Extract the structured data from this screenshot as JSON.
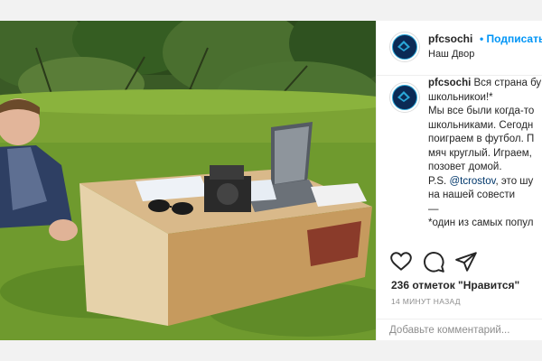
{
  "post": {
    "username": "pfcsochi",
    "follow_label": "• Подписаться",
    "location": "Наш Двор",
    "caption_lines": [
      "Вся страна бу",
      "школьникои!*",
      "Мы все были когда-то",
      "школьниками. Сегодн",
      "поиграем в футбол. П",
      "мяч круглый. Играем,",
      "позовет домой.",
      "P.S. ",
      "на нашей совести",
      "—",
      "*один из самых попул"
    ],
    "caption_mention": "@tcrostov",
    "caption_mention_after": ", это шу",
    "likes_text": "236 отметок \"Нравится\"",
    "time_text": "14 МИНУТ НАЗАД",
    "comment_placeholder": "Добавьте комментарий..."
  },
  "icons": [
    "heart-icon",
    "comment-icon",
    "share-icon"
  ],
  "colors": {
    "link": "#0095f6",
    "mention": "#00376b",
    "text": "#262626",
    "muted": "#8e8e8e"
  }
}
